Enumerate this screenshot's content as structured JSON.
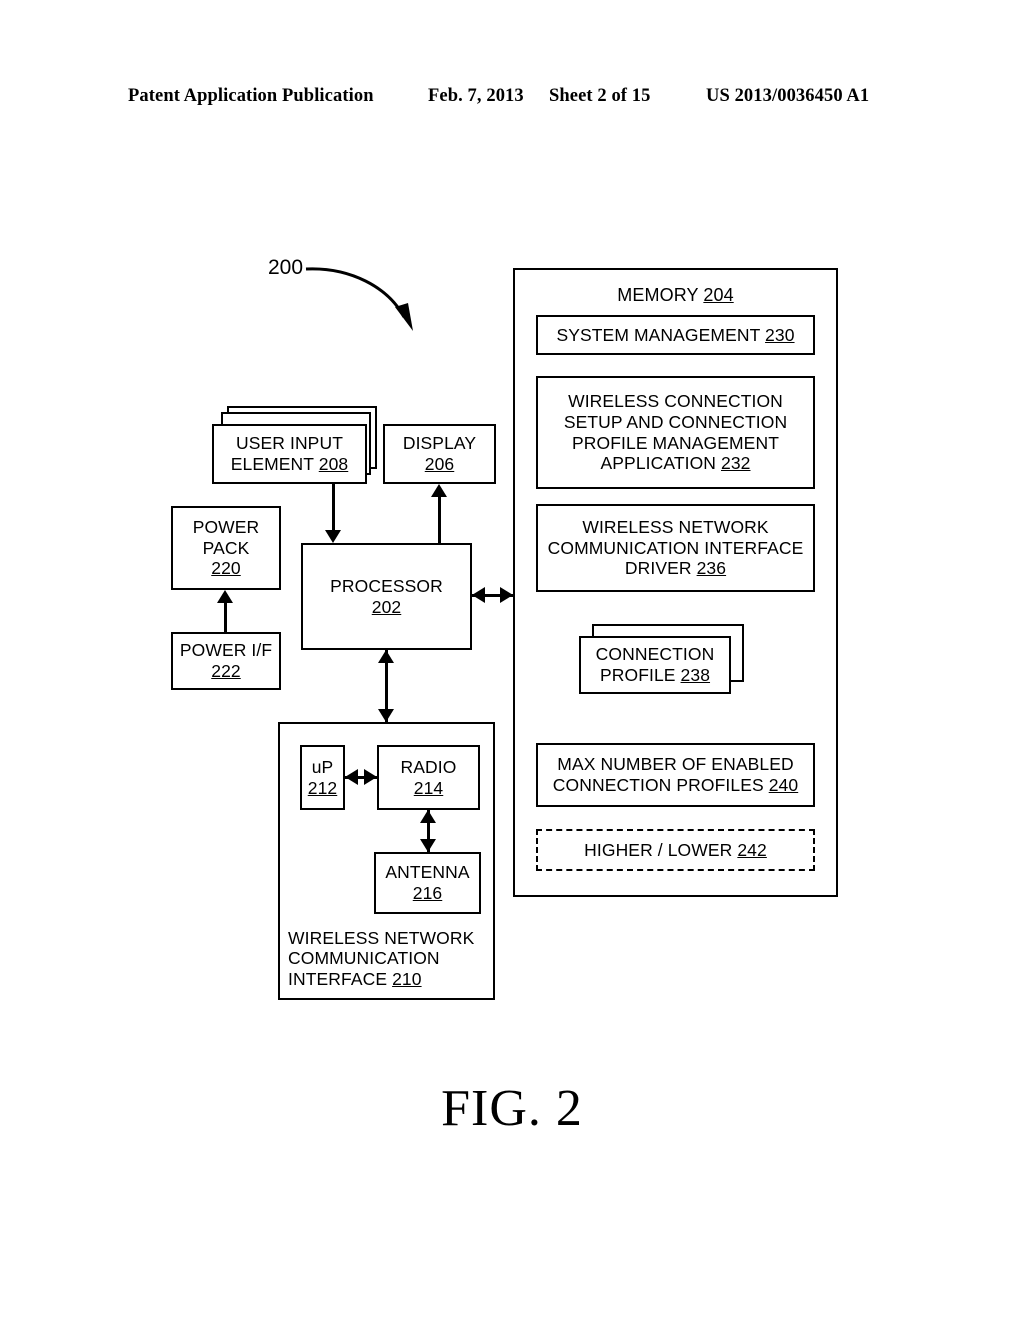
{
  "header": {
    "publication": "Patent Application Publication",
    "date": "Feb. 7, 2013",
    "sheet": "Sheet 2 of 15",
    "number": "US 2013/0036450 A1"
  },
  "figure": {
    "caption": "FIG. 2",
    "system_ref": "200"
  },
  "blocks": {
    "memory": {
      "label": "MEMORY",
      "ref": "204"
    },
    "system_management": {
      "label": "SYSTEM MANAGEMENT",
      "ref": "230"
    },
    "wireless_app": {
      "line1": "WIRELESS CONNECTION",
      "line2": "SETUP AND CONNECTION",
      "line3": "PROFILE MANAGEMENT",
      "line4": "APPLICATION",
      "ref": "232"
    },
    "wnci_driver": {
      "line1": "WIRELESS NETWORK",
      "line2": "COMMUNICATION INTERFACE",
      "line3": "DRIVER",
      "ref": "236"
    },
    "connection_profile": {
      "line1": "CONNECTION",
      "line2": "PROFILE",
      "ref": "238"
    },
    "max_profiles": {
      "line1": "MAX NUMBER OF ENABLED",
      "line2": "CONNECTION PROFILES",
      "ref": "240"
    },
    "higher_lower": {
      "label": "HIGHER / LOWER",
      "ref": "242"
    },
    "user_input": {
      "line1": "USER INPUT",
      "line2": "ELEMENT",
      "ref": "208"
    },
    "display": {
      "label": "DISPLAY",
      "ref": "206"
    },
    "power_pack": {
      "line1": "POWER",
      "line2": "PACK",
      "ref": "220"
    },
    "power_if": {
      "label": "POWER I/F",
      "ref": "222"
    },
    "processor": {
      "label": "PROCESSOR",
      "ref": "202"
    },
    "up": {
      "label": "uP",
      "ref": "212"
    },
    "radio": {
      "label": "RADIO",
      "ref": "214"
    },
    "antenna": {
      "label": "ANTENNA",
      "ref": "216"
    },
    "wnci": {
      "line1": "WIRELESS NETWORK",
      "line2": "COMMUNICATION",
      "line3": "INTERFACE",
      "ref": "210"
    }
  },
  "colors": {
    "ink": "#000000",
    "paper": "#ffffff"
  }
}
